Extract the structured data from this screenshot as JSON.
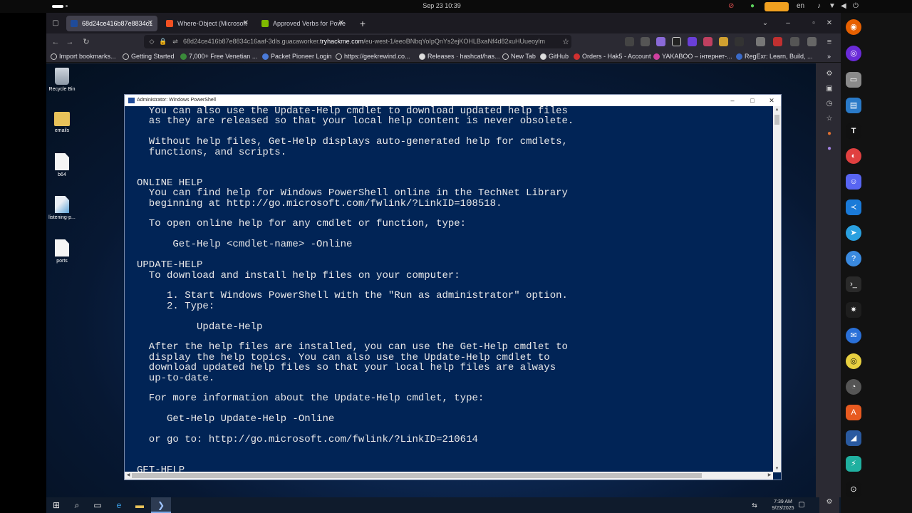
{
  "os_bar": {
    "clock": "Sep 23  10:39",
    "lang": "en"
  },
  "browser": {
    "tabs": [
      {
        "label": "68d24ce416b87e8834c1",
        "active": true
      },
      {
        "label": "Where-Object (Microsoft",
        "active": false
      },
      {
        "label": "Approved Verbs for Powe",
        "active": false
      }
    ],
    "url_prefix": "68d24ce416b87e8834c16aaf-3dls.guacaworker.",
    "url_host": "tryhackme.com",
    "url_rest": "/eu-west-1/eeoBNbqYoIpQnYs2ejKOHLBxaNf4d82xuHUueoylm",
    "bookmarks": [
      "Import bookmarks...",
      "Getting Started",
      "7,000+ Free Venetian ...",
      "Packet Pioneer Login",
      "https://geekrewind.co...",
      "Releases · hashcat/has...",
      "New Tab",
      "GitHub",
      "Orders - Hak5 - Account",
      "YAKABOO – інтернет-...",
      "RegExr: Learn, Build, ..."
    ]
  },
  "desktop": {
    "icons": [
      {
        "label": "Recycle Bin",
        "kind": "bin"
      },
      {
        "label": "emails",
        "kind": "folder"
      },
      {
        "label": "b64",
        "kind": "file"
      },
      {
        "label": "listening-p...",
        "kind": "img"
      },
      {
        "label": "ports",
        "kind": "file"
      }
    ]
  },
  "powershell": {
    "title": "Administrator: Windows PowerShell",
    "lines": [
      "  You can also use the Update-Help cmdlet to download updated help files",
      "  as they are released so that your local help content is never obsolete.",
      "",
      "  Without help files, Get-Help displays auto-generated help for cmdlets,",
      "  functions, and scripts.",
      "",
      "",
      "ONLINE HELP",
      "  You can find help for Windows PowerShell online in the TechNet Library",
      "  beginning at http://go.microsoft.com/fwlink/?LinkID=108518.",
      "",
      "  To open online help for any cmdlet or function, type:",
      "",
      "      Get-Help <cmdlet-name> -Online",
      "",
      "UPDATE-HELP",
      "  To download and install help files on your computer:",
      "",
      "     1. Start Windows PowerShell with the \"Run as administrator\" option.",
      "     2. Type:",
      "",
      "          Update-Help",
      "",
      "  After the help files are installed, you can use the Get-Help cmdlet to",
      "  display the help topics. You can also use the Update-Help cmdlet to",
      "  download updated help files so that your local help files are always",
      "  up-to-date.",
      "",
      "  For more information about the Update-Help cmdlet, type:",
      "",
      "     Get-Help Update-Help -Online",
      "",
      "  or go to: http://go.microsoft.com/fwlink/?LinkID=210614",
      "",
      "",
      "GET-HELP"
    ]
  },
  "taskbar": {
    "time": "7:39 AM",
    "date": "9/23/2025"
  },
  "colors": {
    "console_bg": "#012456",
    "console_fg": "#e8e8e8",
    "accent_badge": "#f0a020"
  }
}
